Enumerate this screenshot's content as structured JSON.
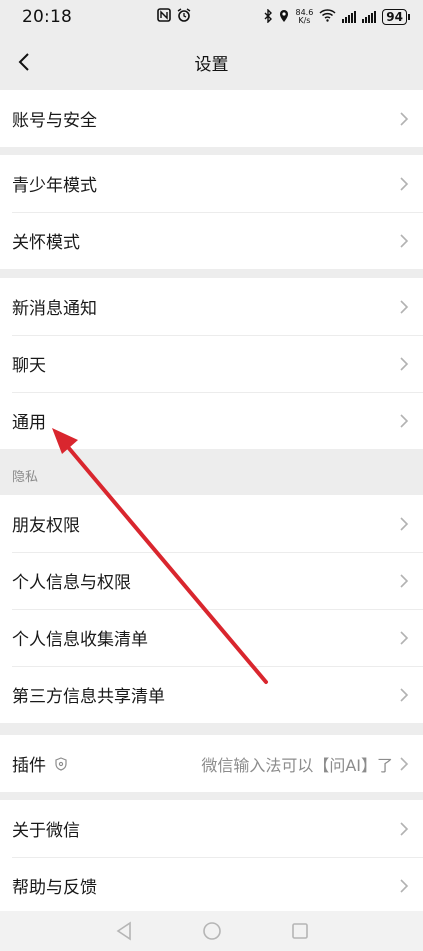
{
  "status_bar": {
    "time": "20:18",
    "speed_top": "84.6",
    "speed_bottom": "K/s",
    "battery": "94"
  },
  "nav": {
    "title": "设置"
  },
  "groups": {
    "account": [
      "账号与安全"
    ],
    "modes": [
      "青少年模式",
      "关怀模式"
    ],
    "general": [
      "新消息通知",
      "聊天",
      "通用"
    ],
    "privacy_header": "隐私",
    "privacy": [
      "朋友权限",
      "个人信息与权限",
      "个人信息收集清单",
      "第三方信息共享清单"
    ],
    "plugin_label": "插件",
    "plugin_value": "微信输入法可以【问AI】了",
    "about": [
      "关于微信",
      "帮助与反馈"
    ]
  },
  "colors": {
    "background": "#ededed",
    "card": "#ffffff",
    "annotation_arrow": "#d9262e"
  },
  "icons": {
    "back": "chevron-left-icon",
    "row_chevron": "chevron-right-icon",
    "plugin": "plugin-shield-icon",
    "annotation": "red-arrow-icon"
  }
}
